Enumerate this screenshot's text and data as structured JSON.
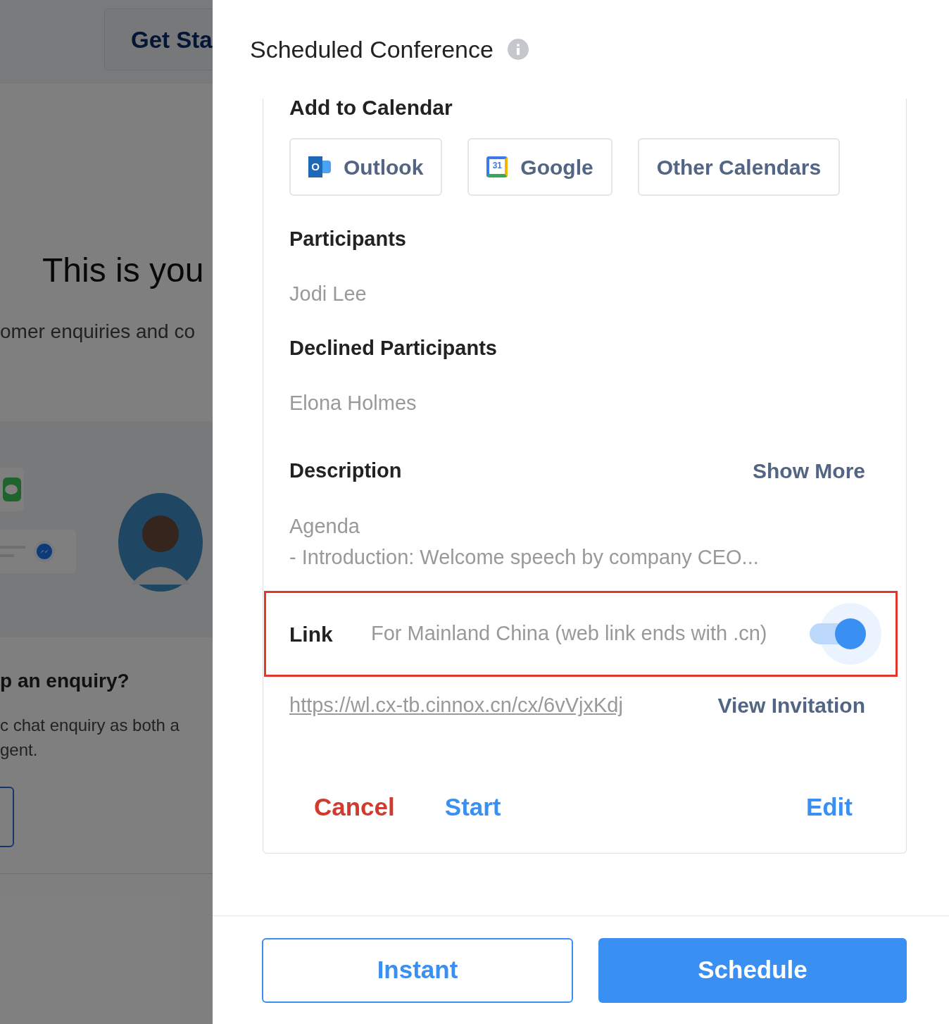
{
  "background_page": {
    "header_button": "Get Sta",
    "headline": "This is you",
    "subtitle": "omer enquiries and co",
    "question": "p an enquiry?",
    "paragraph": "c chat enquiry as both a\ngent."
  },
  "drawer": {
    "title": "Scheduled Conference",
    "add_to_calendar": {
      "heading": "Add to Calendar",
      "buttons": [
        {
          "kind": "outlook",
          "label": "Outlook",
          "icon_text": "O"
        },
        {
          "kind": "google",
          "label": "Google",
          "icon_text": "31"
        },
        {
          "kind": "plain",
          "label": "Other Calendars"
        }
      ]
    },
    "participants": {
      "heading": "Participants",
      "names": [
        "Jodi Lee"
      ]
    },
    "declined_participants": {
      "heading": "Declined Participants",
      "names": [
        "Elona Holmes"
      ]
    },
    "description": {
      "heading": "Description",
      "show_more": "Show More",
      "lines": [
        "Agenda",
        "- Introduction: Welcome speech by company CEO..."
      ]
    },
    "link": {
      "label": "Link",
      "option": "For Mainland China (web link ends with .cn)",
      "on": true,
      "url": "https://wl.cx-tb.cinnox.cn/cx/6vVjxKdj",
      "view_invitation": "View Invitation"
    },
    "actions": [
      "Cancel",
      "Start",
      "Edit"
    ],
    "footer_buttons": [
      {
        "label": "Instant",
        "primary": false
      },
      {
        "label": "Schedule",
        "primary": true
      }
    ]
  }
}
